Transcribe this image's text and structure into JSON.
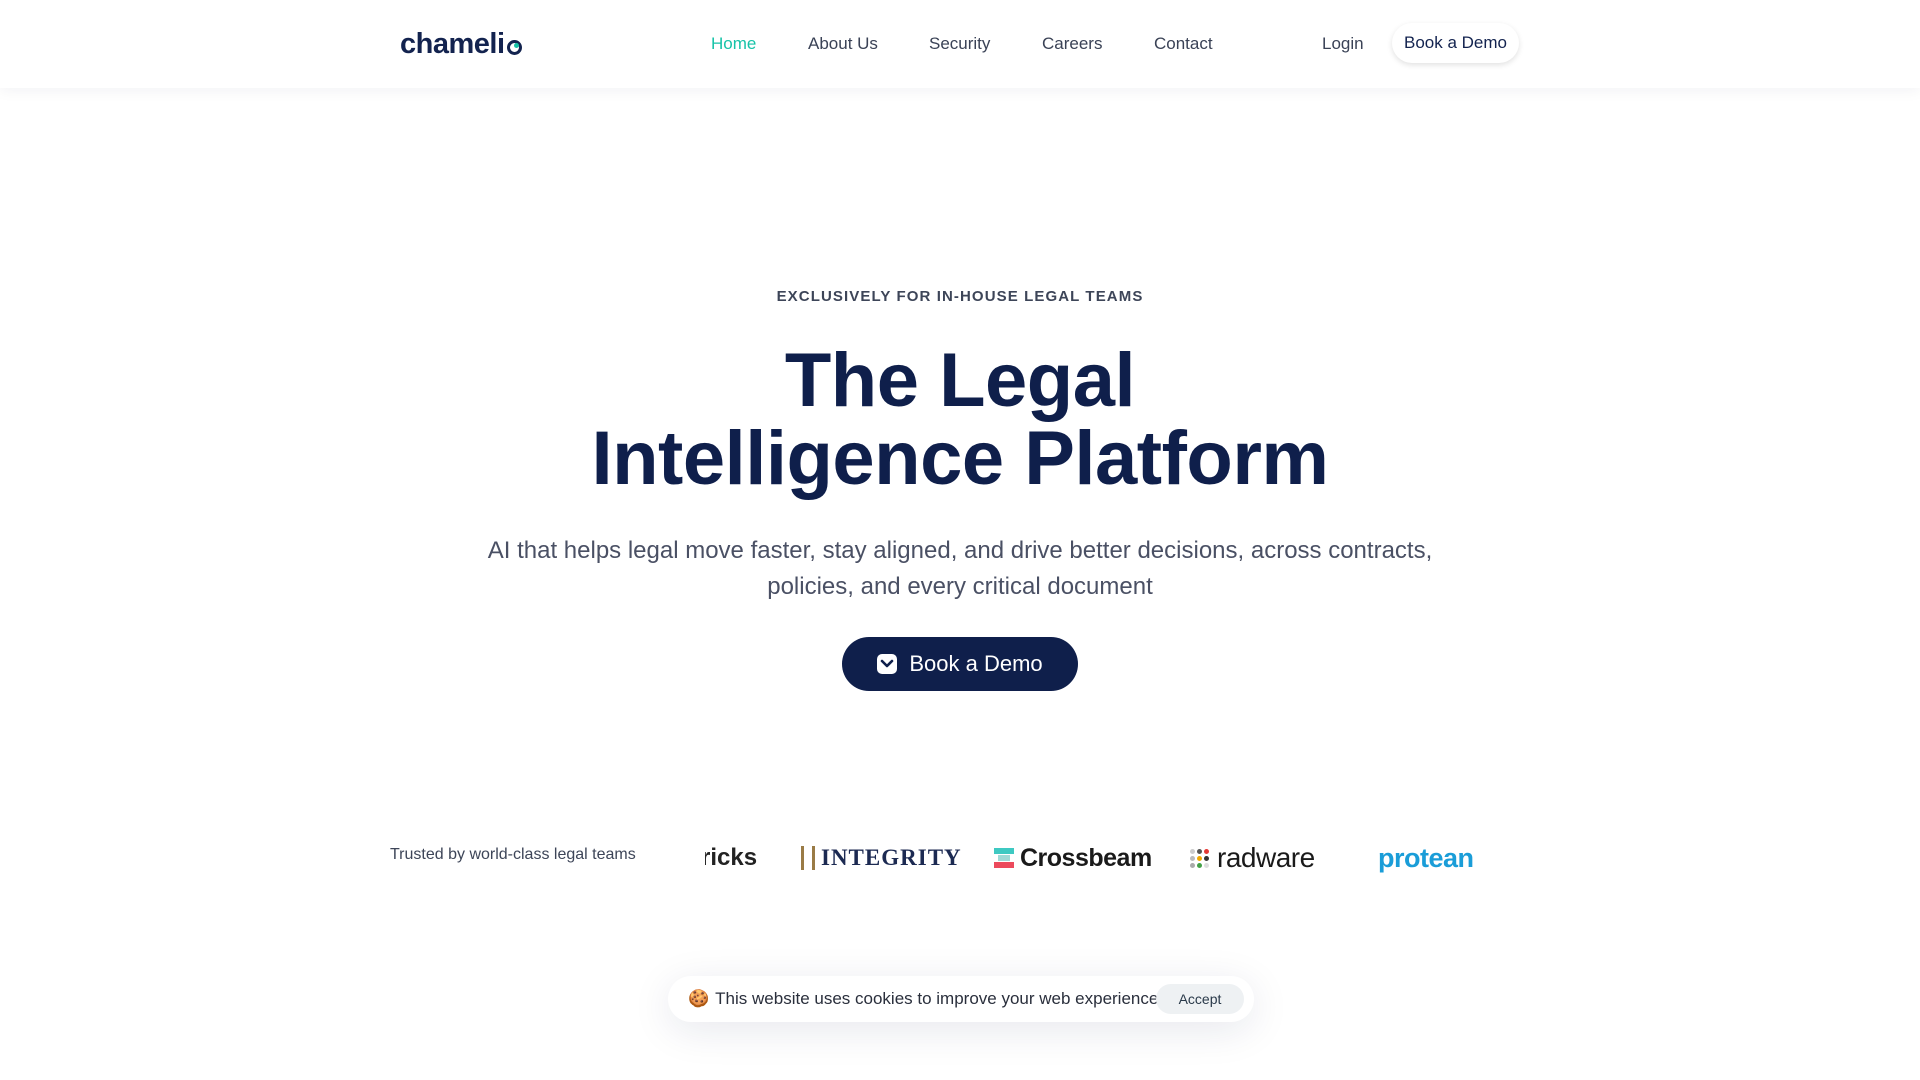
{
  "header": {
    "logo_text": "chameli",
    "nav": [
      {
        "label": "Home",
        "active": true
      },
      {
        "label": "About Us",
        "active": false
      },
      {
        "label": "Security",
        "active": false
      },
      {
        "label": "Careers",
        "active": false
      },
      {
        "label": "Contact",
        "active": false
      }
    ],
    "login_label": "Login",
    "demo_label": "Book a Demo"
  },
  "hero": {
    "eyebrow": "EXCLUSIVELY FOR IN-HOUSE LEGAL TEAMS",
    "title_line1": "The Legal",
    "title_line2": "Intelligence Platform",
    "subtitle_line1": "AI that helps legal move faster, stay aligned, and drive better decisions, across contracts,",
    "subtitle_line2": "policies, and every critical document",
    "cta_label": "Book a Demo",
    "cta_icon": "pocket-icon"
  },
  "trusted": {
    "label": "Trusted by world-class legal teams",
    "logos": [
      "ricks",
      "INTEGRITY",
      "Crossbeam",
      "radware",
      "protean"
    ]
  },
  "cookie_banner": {
    "icon": "🍪",
    "text": "This website uses cookies to improve your web experience.",
    "accept_label": "Accept"
  },
  "colors": {
    "brand_navy": "#0f1f4b",
    "accent_teal": "#17c3a8",
    "protean_blue": "#1a9dd8"
  }
}
